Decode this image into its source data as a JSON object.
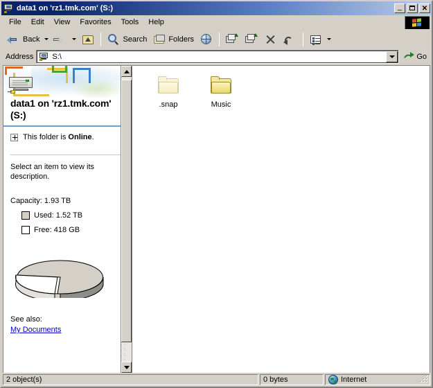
{
  "window": {
    "title": "data1 on 'rz1.tmk.com' (S:)",
    "title_icon": "network-drive-icon",
    "minimize_label": "_",
    "maximize_label": "",
    "close_label": "✕"
  },
  "menu": {
    "items": [
      {
        "label": "File"
      },
      {
        "label": "Edit"
      },
      {
        "label": "View"
      },
      {
        "label": "Favorites"
      },
      {
        "label": "Tools"
      },
      {
        "label": "Help"
      }
    ],
    "logo": "windows-flag-icon"
  },
  "toolbar": {
    "back_label": "Back",
    "search_label": "Search",
    "folders_label": "Folders",
    "icons": {
      "back": "back-arrow-icon",
      "forward": "forward-arrow-icon",
      "up": "up-folder-icon",
      "search": "magnifier-icon",
      "folders": "folders-icon",
      "history": "history-globe-icon",
      "move_to": "move-to-icon",
      "copy_to": "copy-to-icon",
      "delete": "delete-x-icon",
      "undo": "undo-arrow-icon",
      "views": "views-icon"
    }
  },
  "address": {
    "label": "Address",
    "value": "S:\\",
    "placeholder": "S:\\",
    "icon": "network-drive-icon",
    "go_label": "Go"
  },
  "sidebar": {
    "title": "data1 on 'rz1.tmk.com' (S:)",
    "online_prefix": "This folder is ",
    "online_state": "Online",
    "online_suffix": ".",
    "description": "Select an item to view its description.",
    "capacity_label": "Capacity: 1.93 TB",
    "legend": [
      {
        "name": "used",
        "label": "Used: 1.52 TB",
        "color": "#d4d0c8"
      },
      {
        "name": "free",
        "label": "Free: 418 GB",
        "color": "#ffffff"
      }
    ],
    "see_also_label": "See also:",
    "links": [
      {
        "label": "My Documents",
        "color": "#0000cc"
      }
    ],
    "accent_rule_color": "#6a9fd4"
  },
  "chart_data": {
    "type": "pie",
    "title": "Disk usage",
    "categories": [
      "Used",
      "Free"
    ],
    "values": [
      1.52,
      0.418
    ],
    "units": "TB",
    "display_labels": [
      "Used: 1.52 TB",
      "Free: 418 GB"
    ],
    "colors": [
      "#d4d0c8",
      "#ffffff"
    ],
    "percentages": [
      78.4,
      21.6
    ],
    "exploded_slice": "Free",
    "three_d": true,
    "legend": "above",
    "grid": false,
    "total_label": "Capacity: 1.93 TB"
  },
  "files": {
    "items": [
      {
        "name": ".snap",
        "icon": "folder-icon",
        "hidden": true
      },
      {
        "name": "Music",
        "icon": "folder-icon",
        "hidden": false
      }
    ]
  },
  "statusbar": {
    "objects": "2 object(s)",
    "size": "0 bytes",
    "zone": "Internet",
    "zone_icon": "internet-zone-globe-icon"
  }
}
